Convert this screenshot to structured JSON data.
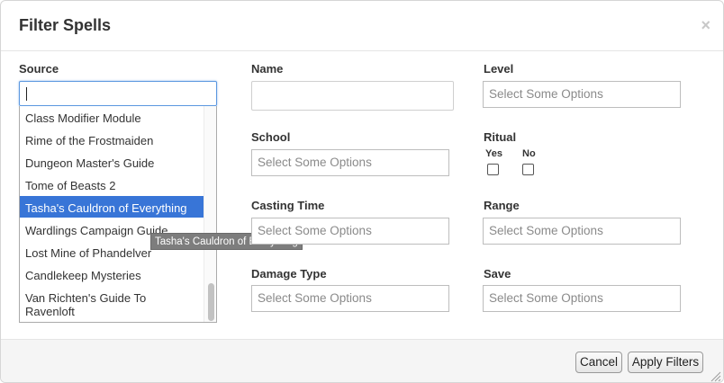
{
  "dialog": {
    "title": "Filter Spells",
    "close_glyph": "×"
  },
  "fields": {
    "source": {
      "label": "Source",
      "search_value": ""
    },
    "name": {
      "label": "Name",
      "value": ""
    },
    "level": {
      "label": "Level",
      "placeholder": "Select Some Options"
    },
    "school": {
      "label": "School",
      "placeholder": "Select Some Options"
    },
    "ritual": {
      "label": "Ritual",
      "yes_label": "Yes",
      "no_label": "No",
      "yes_checked": false,
      "no_checked": false
    },
    "casting_time": {
      "label": "Casting Time",
      "placeholder": "Select Some Options"
    },
    "range": {
      "label": "Range",
      "placeholder": "Select Some Options"
    },
    "damage_type": {
      "label": "Damage Type",
      "placeholder": "Select Some Options"
    },
    "save": {
      "label": "Save",
      "placeholder": "Select Some Options"
    }
  },
  "source_options": [
    "Class Modifier Module",
    "Rime of the Frostmaiden",
    "Dungeon Master's Guide",
    "Tome of Beasts 2",
    "Tasha's Cauldron of Everything",
    "Wardlings Campaign Guide",
    "Lost Mine of Phandelver",
    "Candlekeep Mysteries",
    "Van Richten's Guide To Ravenloft"
  ],
  "source_options_line2": {
    "8": "Ravenloft"
  },
  "source_options_line1": {
    "8": "Van Richten's Guide To"
  },
  "highlighted_option": "Tasha's Cauldron of Everything",
  "tooltip": {
    "text": "Tasha's Cauldron of Everything"
  },
  "footer": {
    "cancel_label": "Cancel",
    "apply_label": "Apply Filters"
  },
  "colors": {
    "highlight": "#3875d7",
    "focus_border": "#5b97e0",
    "footer_bg": "#f5f5f5"
  },
  "icons": {
    "close": "close-icon",
    "resize": "resize-grip-icon"
  }
}
